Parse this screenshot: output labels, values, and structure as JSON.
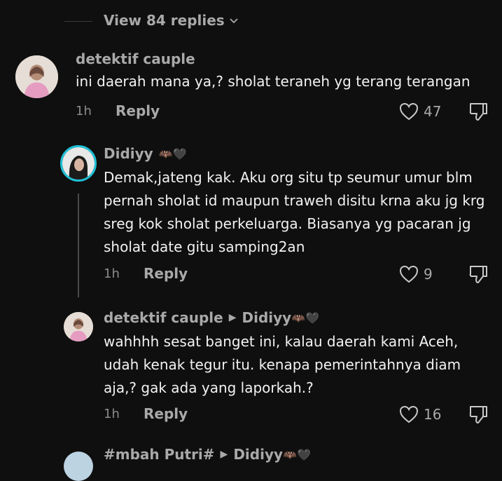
{
  "view_replies": {
    "label": "View 84 replies"
  },
  "comments": [
    {
      "username": "detektif cauple",
      "text": "ini daerah mana ya,? sholat teraneh yg terang terangan",
      "time": "1h",
      "reply_label": "Reply",
      "likes": "47"
    },
    {
      "username": "Didiyy",
      "username_emoji": "🦇🖤",
      "text": "Demak,jateng kak. Aku org situ tp seumur umur blm pernah sholat id maupun traweh disitu krna aku jg krg sreg kok sholat perkeluarga. Biasanya yg pacaran jg sholat date gitu samping2an",
      "time": "1h",
      "reply_label": "Reply",
      "likes": "9"
    },
    {
      "username": "detektif cauple",
      "reply_to": "Didiyy",
      "reply_to_emoji": "🦇🖤",
      "text": "wahhhh sesat banget ini, kalau daerah kami Aceh, udah kenak tegur itu. kenapa pemerintahnya diam aja,? gak ada yang laporkah.?",
      "time": "1h",
      "reply_label": "Reply",
      "likes": "16"
    },
    {
      "username": "#mbah Putri#",
      "reply_to": "Didiyy",
      "reply_to_emoji": "🦇🖤"
    }
  ]
}
